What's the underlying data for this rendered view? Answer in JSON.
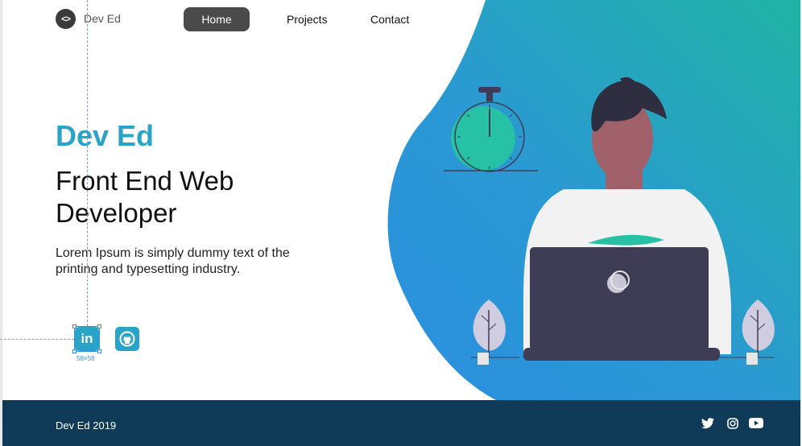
{
  "header": {
    "logo_glyph": "<>",
    "logo_text": "Dev Ed",
    "nav": [
      "Home",
      "Projects",
      "Contact"
    ]
  },
  "hero": {
    "name": "Dev Ed",
    "title": "Front End Web Developer",
    "description": "Lorem Ipsum is simply dummy text of the printing and typesetting industry."
  },
  "socials": {
    "linkedin_glyph": "in",
    "icons": [
      "linkedin-icon",
      "github-icon"
    ]
  },
  "design_overlay": {
    "size_label": "58×58"
  },
  "footer": {
    "text": "Dev Ed 2019",
    "icons": [
      "twitter-icon",
      "instagram-icon",
      "youtube-icon"
    ]
  },
  "colors": {
    "accent": "#2aa3c9",
    "footer_bg": "#0f3a58",
    "blob_top": "#20b0a6",
    "blob_bottom": "#2b8fdc",
    "laptop": "#3f3d56"
  }
}
